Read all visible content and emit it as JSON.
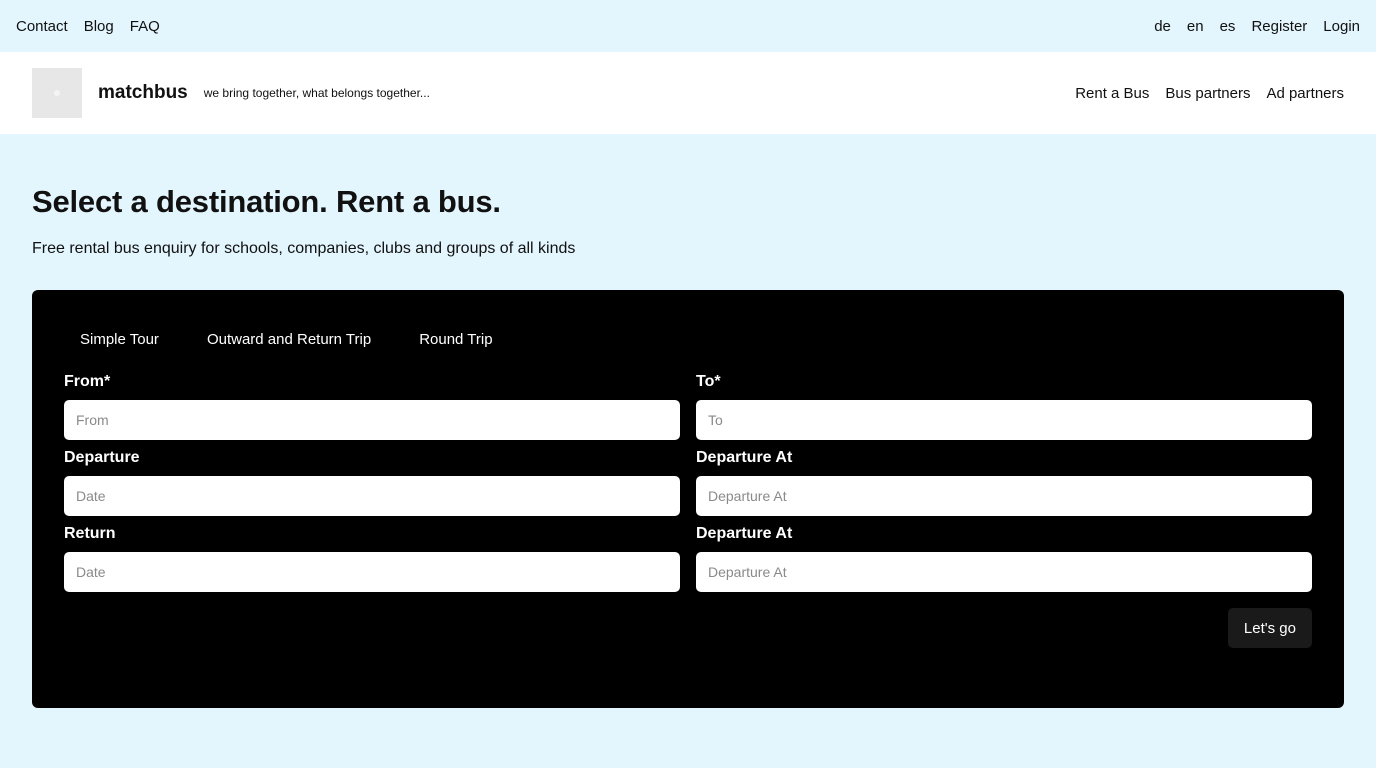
{
  "topbar": {
    "left_links": [
      "Contact",
      "Blog",
      "FAQ"
    ],
    "right_links": [
      "de",
      "en",
      "es",
      "Register",
      "Login"
    ]
  },
  "header": {
    "brand": "matchbus",
    "tagline": "we bring together, what belongs together...",
    "nav": [
      "Rent a Bus",
      "Bus partners",
      "Ad partners"
    ]
  },
  "hero": {
    "title": "Select a destination. Rent a bus.",
    "subtitle": "Free rental bus enquiry for schools, companies, clubs and groups of all kinds"
  },
  "form": {
    "tabs": [
      "Simple Tour",
      "Outward and Return Trip",
      "Round Trip"
    ],
    "from": {
      "label": "From*",
      "placeholder": "From"
    },
    "to": {
      "label": "To*",
      "placeholder": "To"
    },
    "departure": {
      "label": "Departure",
      "placeholder": "Date"
    },
    "departure_at": {
      "label": "Departure At",
      "placeholder": "Departure At"
    },
    "return": {
      "label": "Return",
      "placeholder": "Date"
    },
    "return_departure_at": {
      "label": "Departure At",
      "placeholder": "Departure At"
    },
    "submit_label": "Let's go"
  }
}
